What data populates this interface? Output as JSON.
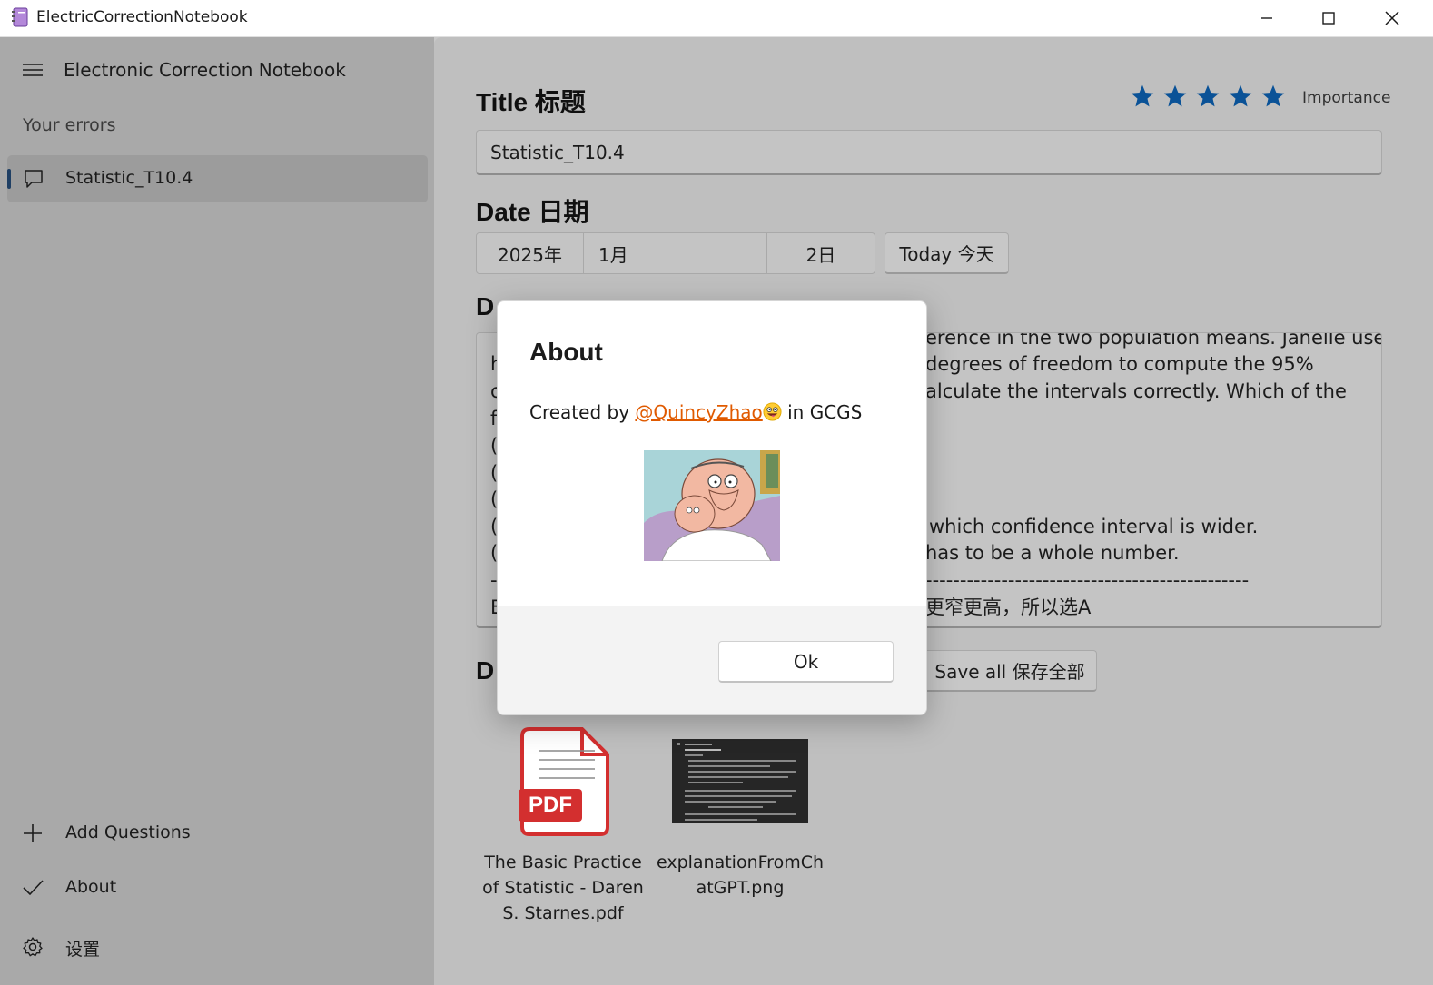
{
  "window": {
    "title": "ElectricCorrectionNotebook",
    "icons": [
      "notebook-app-icon",
      "minimize-icon",
      "maximize-icon",
      "close-icon"
    ]
  },
  "sidebar": {
    "app_name": "Electronic Correction Notebook",
    "section_title": "Your errors",
    "items": [
      {
        "label": "Statistic_T10.4",
        "icon": "chat-bubble-icon"
      }
    ],
    "footer": {
      "add_label": "Add Questions",
      "about_label": "About",
      "settings_label": "设置"
    }
  },
  "main": {
    "title_heading": "Title 标题",
    "importance_label": "Importance",
    "importance_stars": 5,
    "title_value": "Statistic_T10.4",
    "date_heading": "Date 日期",
    "date": {
      "year": "2025年",
      "month": "1月",
      "day": "2日"
    },
    "today_button": "Today 今天",
    "description_heading_visible": "D",
    "description_fragments": {
      "line1_right": "erence in the two population means. Janelle uses",
      "line2_left": "h",
      "line2_right": "degrees of freedom to compute the 95%",
      "line3_left": "c",
      "line3_right": "alculate the intervals correctly. Which of the",
      "line4_left": "f",
      "line5_left": "(",
      "line6_left": "(",
      "line7_left": "(",
      "line8_left": "(",
      "line8_right": "which confidence interval is wider.",
      "line9_left": "(",
      "line9_right": "has to be a whole number.",
      "line10_left": "-",
      "line10_right": "-----------------------------------------------",
      "line11_left": "E",
      "line11_right": "更窄更高，所以选A"
    },
    "documents_heading_visible": "D",
    "save_all_button": "Save all 保存全部",
    "attachments": [
      {
        "name": "The Basic Practice of Statistic - Daren S. Starnes.pdf",
        "icon": "pdf-file-icon",
        "badge": "PDF"
      },
      {
        "name": "explanationFromChatGPT.png",
        "icon": "image-thumbnail"
      }
    ],
    "colors": {
      "star": "#0a5297",
      "accent": "#1f3f64"
    }
  },
  "dialog": {
    "title": "About",
    "text_prefix": "Created by ",
    "link_text": "@QuincyZhao",
    "text_suffix": " in GCGS",
    "link_color": "#e05a00",
    "image": "cartoon-character-avatar",
    "ok_button": "Ok"
  }
}
